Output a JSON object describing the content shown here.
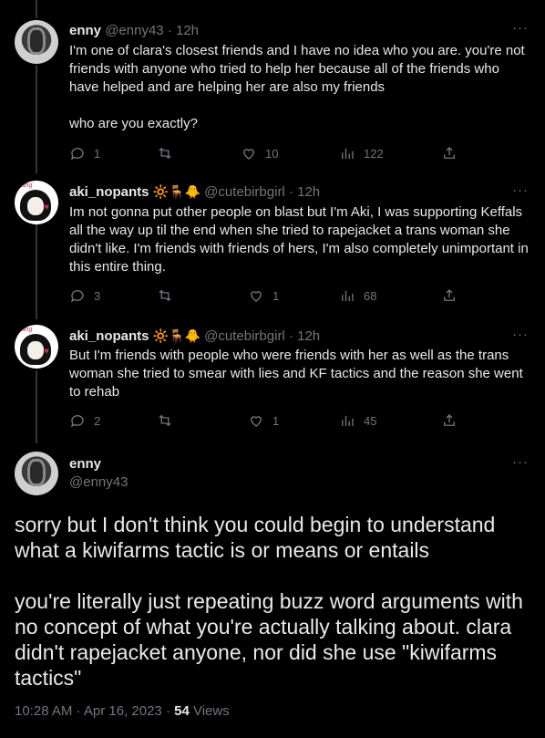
{
  "tweets": [
    {
      "name": "enny",
      "handle": "@enny43",
      "time": "· 12h",
      "badges": "",
      "text": "I'm one of clara's closest friends and I have no idea who you are. you're not friends with anyone who tried to help her because all of the friends who have helped and are helping her are also my friends\n\nwho are you exactly?",
      "replies": "1",
      "retweets": "",
      "likes": "10",
      "views": "122",
      "more": "···"
    },
    {
      "name": "aki_nopants",
      "handle": "@cutebirbgirl",
      "time": "· 12h",
      "badges": "🔆🪑🐥",
      "text": "Im not gonna put other people on blast but I'm Aki, I was supporting Keffals all the way up til the end when she tried to rapejacket a trans woman she didn't like. I'm friends with friends of hers, I'm also completely unimportant in this entire thing.",
      "replies": "3",
      "retweets": "",
      "likes": "1",
      "views": "68",
      "more": "···"
    },
    {
      "name": "aki_nopants",
      "handle": "@cutebirbgirl",
      "time": "· 12h",
      "badges": "🔆🪑🐥",
      "text": "But I'm friends with people who were friends with her as well as the trans woman she tried to smear with lies and KF tactics and the reason she went to rehab",
      "replies": "2",
      "retweets": "",
      "likes": "1",
      "views": "45",
      "more": "···"
    }
  ],
  "main_tweet": {
    "name": "enny",
    "handle": "@enny43",
    "more": "···",
    "text": "sorry but I don't think you could begin to understand what a kiwifarms tactic is or means or entails\n\nyou're literally just repeating buzz word arguments with no concept of what you're actually talking about. clara didn't rapejacket anyone, nor did she use \"kiwifarms tactics\"",
    "timestamp": "10:28 AM · Apr 16, 2023 · ",
    "views_count": "54",
    "views_label": " Views"
  },
  "icons": [
    "reply-icon",
    "retweet-icon",
    "like-icon",
    "views-icon",
    "share-icon",
    "more-icon"
  ],
  "avatar_tag": "Bang"
}
